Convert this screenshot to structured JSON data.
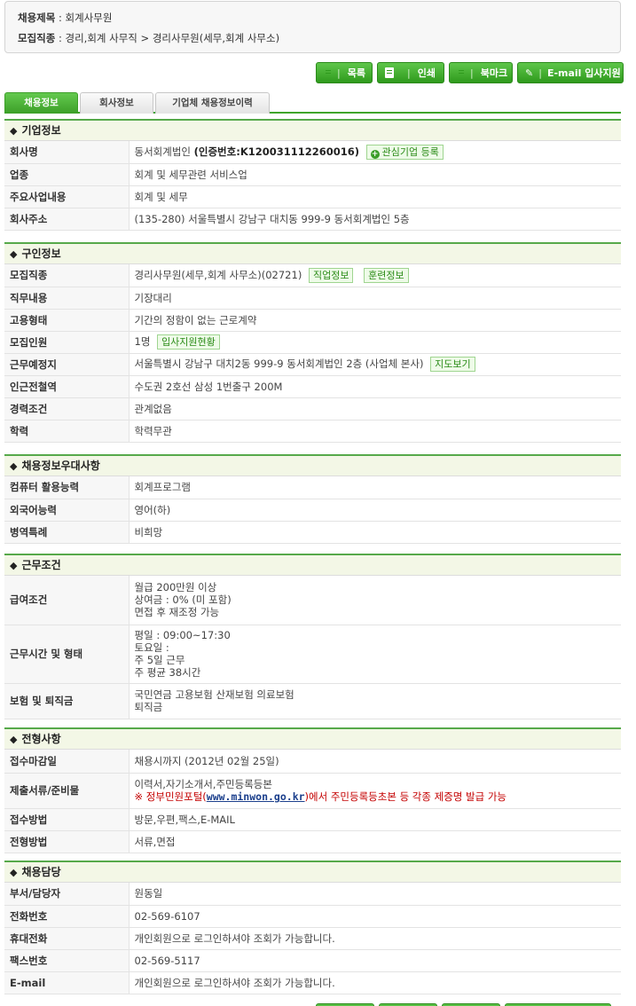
{
  "summary": {
    "title_label": "채용제목",
    "title_value": "회계사무원",
    "category_label": "모집직종",
    "category_value": "경리,회계 사무직 > 경리사무원(세무,회계 사무소)"
  },
  "actions": {
    "list": "목록",
    "print": "인쇄",
    "bookmark": "북마크",
    "apply": "E-mail 입사지원"
  },
  "tabs": [
    "채용정보",
    "회사정보",
    "기업체 채용정보이력"
  ],
  "company": {
    "title": "기업정보",
    "rows": {
      "name_label": "회사명",
      "name_value": "동서회계법인",
      "cert": "(인증번호:K120031112260016)",
      "interest_tag": "관심기업 등록",
      "industry_label": "업종",
      "industry_value": "회계 및 세무관련 서비스업",
      "business_label": "주요사업내용",
      "business_value": "회계 및 세무",
      "address_label": "회사주소",
      "address_value": "(135-280) 서울특별시 강남구 대치동 999-9 동서회계법인 5층"
    }
  },
  "job": {
    "title": "구인정보",
    "rows": {
      "category_label": "모집직종",
      "category_value": "경리사무원(세무,회계 사무소)(02721)",
      "job_info_tag": "직업정보",
      "training_tag": "훈련정보",
      "duty_label": "직무내용",
      "duty_value": "기장대리",
      "employment_label": "고용형태",
      "employment_value": "기간의 정함이 없는 근로계약",
      "headcount_label": "모집인원",
      "headcount_value": "1명",
      "applicants_tag": "입사지원현황",
      "workplace_label": "근무예정지",
      "workplace_value": "서울특별시 강남구 대치2동 999-9 동서회계법인 2층 (사업체 본사)",
      "map_tag": "지도보기",
      "transit_label": "인근전철역",
      "transit_value": "수도권 2호선 삼성 1번출구 200M",
      "career_label": "경력조건",
      "career_value": "관계없음",
      "education_label": "학력",
      "education_value": "학력무관"
    }
  },
  "preference": {
    "title": "채용정보우대사항",
    "rows": {
      "computer_label": "컴퓨터 활용능력",
      "computer_value": "회계프로그램",
      "language_label": "외국어능력",
      "language_value": "영어(하)",
      "military_label": "병역특례",
      "military_value": "비희망"
    }
  },
  "conditions": {
    "title": "근무조건",
    "rows": {
      "salary_label": "급여조건",
      "salary_lines": [
        "월급 200만원 이상",
        "상여금 : 0% (미 포함)",
        "면접 후 재조정 가능"
      ],
      "hours_label": "근무시간 및 형태",
      "hours_lines": [
        "평일 : 09:00~17:30",
        "토요일 :",
        "주 5일 근무",
        "주 평균 38시간"
      ],
      "insurance_label": "보험 및 퇴직금",
      "insurance_lines": [
        "국민연금 고용보험 산재보험 의료보험",
        "퇴직금"
      ]
    }
  },
  "selection": {
    "title": "전형사항",
    "rows": {
      "deadline_label": "접수마감일",
      "deadline_value": "채용시까지 (2012년 02월 25일)",
      "docs_label": "제출서류/준비물",
      "docs_line1": "이력서,자기소개서,주민등록등본",
      "docs_note_prefix": "※ 정부민원포털(",
      "docs_note_link": "www.minwon.go.kr",
      "docs_note_suffix": ")에서 주민등록등초본 등 각종 제증명 발급 가능",
      "method_label": "접수방법",
      "method_value": "방문,우편,팩스,E-MAIL",
      "process_label": "전형방법",
      "process_value": "서류,면접"
    }
  },
  "contact": {
    "title": "채용담당",
    "rows": {
      "person_label": "부서/담당자",
      "person_value": "원동일",
      "phone_label": "전화번호",
      "phone_value": "02-569-6107",
      "mobile_label": "휴대전화",
      "mobile_value": "개인회원으로 로그인하셔야 조회가 가능합니다.",
      "fax_label": "팩스번호",
      "fax_value": "02-569-5117",
      "email_label": "E-mail",
      "email_value": "개인회원으로 로그인하셔야 조회가 가능합니다."
    }
  },
  "colors": {
    "accent": "#3fa52a",
    "section_bg": "#f3f7e6",
    "note_red": "#c40000"
  }
}
